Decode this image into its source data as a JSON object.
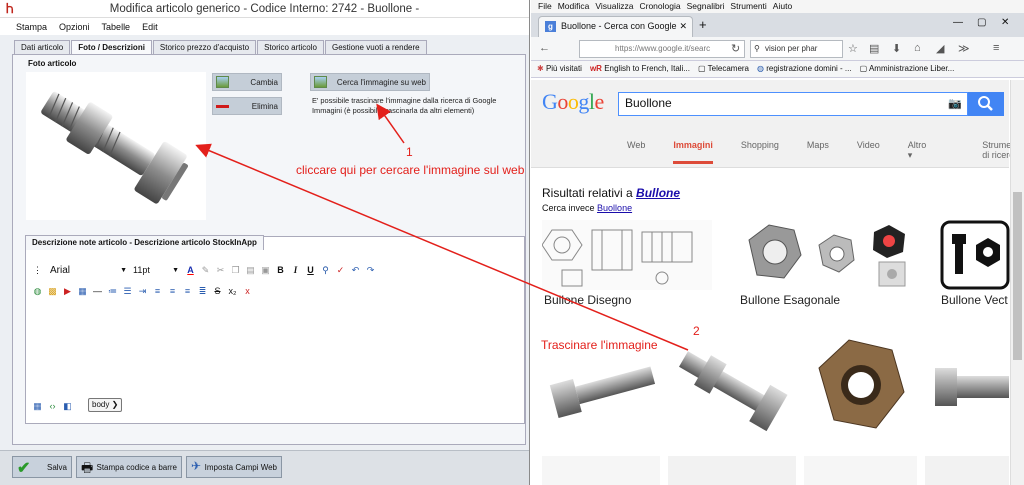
{
  "left_window": {
    "title": "Modifica articolo generico - Codice Interno: 2742 - Buollone -",
    "menu": [
      "Stampa",
      "Opzioni",
      "Tabelle",
      "Edit"
    ],
    "tabs": [
      "Dati articolo",
      "Foto / Descrizioni",
      "Storico prezzo d'acquisto",
      "Storico articolo",
      "Gestione vuoti a rendere"
    ],
    "foto_group": "Foto articolo",
    "btn_cambia": "Cambia",
    "btn_elimina": "Elimina",
    "btn_cerca": "Cerca l'immagine su web",
    "hint": "E' possibile trascinare l'immagine dalla ricerca di Google Immagini (è possibile trascinarla da altri elementi)",
    "desc_group": "Descrizione note articolo - Descrizione articolo StockInApp",
    "font": "Arial",
    "size": "11pt",
    "body_tag": "body",
    "footer": {
      "save": "Salva",
      "print": "Stampa codice a barre",
      "web": "Imposta Campi Web"
    }
  },
  "browser": {
    "menu": [
      "File",
      "Modifica",
      "Visualizza",
      "Cronologia",
      "Segnalibri",
      "Strumenti",
      "Aiuto"
    ],
    "tab_title": "Buollone - Cerca con Google",
    "url": "https://www.google.it/searc",
    "search_value": "vision per phar",
    "bookmarks": [
      "Più visitati",
      "English to French, Itali...",
      "Telecamera",
      "registrazione domini - ...",
      "Amministrazione Liber..."
    ]
  },
  "google": {
    "logo": "Google",
    "query": "Buollone",
    "nav": [
      "Web",
      "Immagini",
      "Shopping",
      "Maps",
      "Video",
      "Altro",
      "Strumenti di ricerca"
    ],
    "results_prefix": "Risultati relativi a",
    "results_term": "Bullone",
    "instead_prefix": "Cerca invece",
    "instead_term": "Buollone",
    "categories": [
      "Bullone Disegno",
      "Bullone Esagonale",
      "Bullone Vect"
    ]
  },
  "annotations": {
    "n1": "1",
    "text1": "cliccare qui per cercare l'immagine sul web",
    "n2": "2",
    "text2": "Trascinare l'immagine"
  }
}
